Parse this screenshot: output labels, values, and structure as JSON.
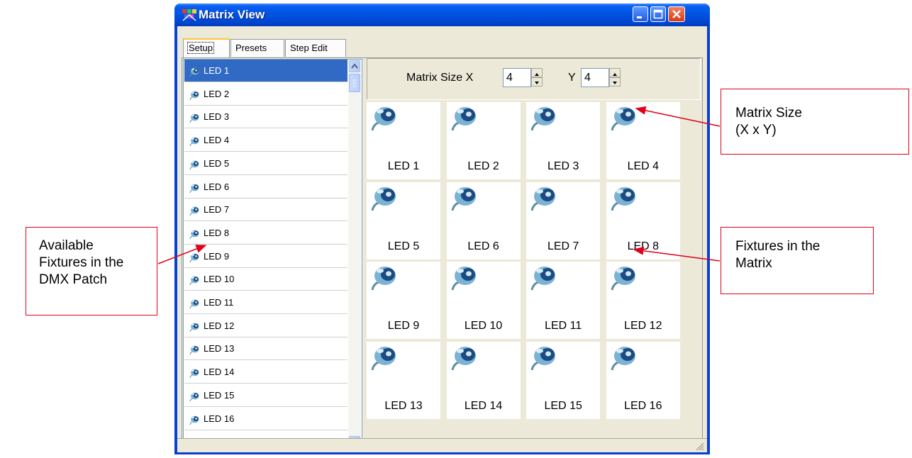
{
  "window": {
    "title": "Matrix View"
  },
  "tabs": [
    {
      "label": "Setup",
      "active": true
    },
    {
      "label": "Presets",
      "active": false
    },
    {
      "label": "Step Edit",
      "active": false
    }
  ],
  "fixture_list": {
    "items": [
      "LED 1",
      "LED 2",
      "LED 3",
      "LED 4",
      "LED 5",
      "LED 6",
      "LED 7",
      "LED 8",
      "LED 9",
      "LED 10",
      "LED 11",
      "LED 12",
      "LED 13",
      "LED 14",
      "LED 15",
      "LED 16"
    ],
    "selected": "LED 1"
  },
  "matrix_size": {
    "label_x": "Matrix Size X",
    "x_value": "4",
    "label_y": "Y",
    "y_value": "4"
  },
  "matrix_cells": [
    "LED 1",
    "LED 2",
    "LED 3",
    "LED 4",
    "LED 5",
    "LED 6",
    "LED 7",
    "LED 8",
    "LED 9",
    "LED 10",
    "LED 11",
    "LED 12",
    "LED 13",
    "LED 14",
    "LED 15",
    "LED 16"
  ],
  "callouts": {
    "matrix_size": {
      "line1": "Matrix Size",
      "line2": "(X x Y)"
    },
    "fixtures_in_matrix": {
      "line1": "Fixtures in the",
      "line2": "Matrix"
    },
    "available_fixtures": {
      "line1": "Available",
      "line2": "Fixtures in the",
      "line3": "DMX Patch"
    }
  },
  "colors": {
    "title_bar": "#0054e3",
    "selection": "#316ac5",
    "callout_border": "#e0001a",
    "window_bg": "#ece9d8"
  },
  "icons": {
    "app": "matrix-app-icon",
    "fixture": "spotlight-fixture-icon"
  }
}
